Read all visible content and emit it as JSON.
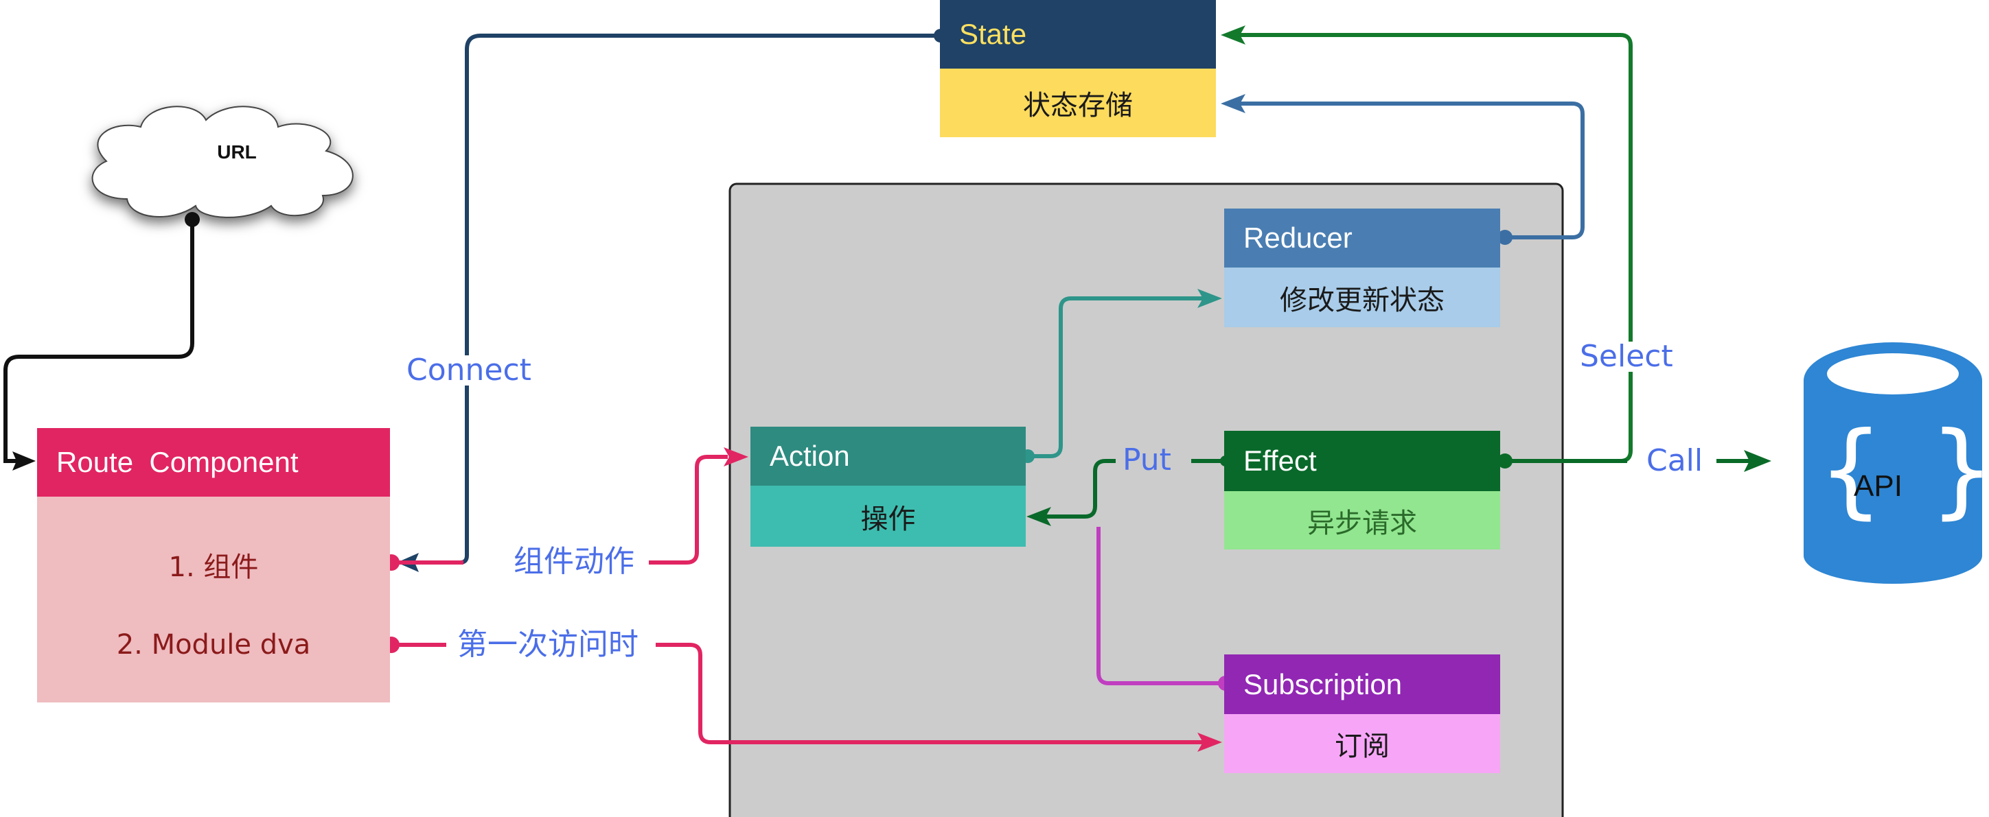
{
  "nodes": {
    "state": {
      "title": "State",
      "subtitle": "状态存储"
    },
    "reducer": {
      "title": "Reducer",
      "subtitle": "修改更新状态"
    },
    "action": {
      "title": "Action",
      "subtitle": "操作"
    },
    "effect": {
      "title": "Effect",
      "subtitle": "异步请求"
    },
    "subscription": {
      "title": "Subscription",
      "subtitle": "订阅"
    },
    "route_component": {
      "title": "Route  Component",
      "item1": "1. 组件",
      "item2": "2. Module dva"
    },
    "url": {
      "label": "URL"
    },
    "api": {
      "label": "API",
      "brace_left": "{",
      "brace_right": "}"
    }
  },
  "edges": {
    "connect": "Connect",
    "component_action": "组件动作",
    "first_visit": "第一次访问时",
    "put": "Put",
    "select": "Select",
    "call": "Call"
  },
  "colors": {
    "state_header": "#1f4266",
    "state_body": "#fddb5c",
    "state_title_text": "#fde060",
    "reducer_header": "#4a7eb2",
    "reducer_body": "#a8cce9",
    "action_header": "#2e8b80",
    "action_body": "#3dbdb0",
    "effect_header": "#09692a",
    "effect_body": "#92e690",
    "effect_sub_text": "#2a6a2a",
    "subscription_header": "#9227b4",
    "subscription_body": "#f7a6f7",
    "route_header": "#e12562",
    "route_body": "#efbcc0",
    "route_text": "#8b1a1a",
    "model_area": "#cccccc",
    "connect_line": "#1f4266",
    "reducer_line": "#3b6fa3",
    "select_line": "#137a2c",
    "effect_line": "#0a6b28",
    "action_line": "#2e958a",
    "pink_line": "#e12562",
    "subscription_line": "#c03ec0",
    "url_line": "#111111",
    "api_fill": "#2e86d4",
    "label_text": "#4b6ee8"
  }
}
